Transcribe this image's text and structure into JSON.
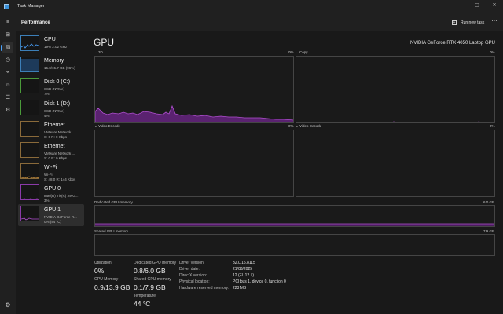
{
  "window": {
    "title": "Task Manager",
    "controls": {
      "minimize": "—",
      "maximize": "▢",
      "close": "✕"
    }
  },
  "header": {
    "page_title": "Performance",
    "run_new_task": "Run new task",
    "more": "⋯"
  },
  "rail_icons": [
    "hamburger-icon",
    "processes-icon",
    "performance-icon",
    "app-history-icon",
    "startup-apps-icon",
    "users-icon",
    "details-icon",
    "services-icon",
    "settings-icon"
  ],
  "sidebar": {
    "items": [
      {
        "name": "CPU",
        "sub1": "19%  2.02 GHz",
        "sub2": "",
        "sub3": ""
      },
      {
        "name": "Memory",
        "sub1": "15.0/15.7 GB (96%)",
        "sub2": "",
        "sub3": ""
      },
      {
        "name": "Disk 0 (C:)",
        "sub1": "SSD (NVMe)",
        "sub2": "7%",
        "sub3": ""
      },
      {
        "name": "Disk 1 (D:)",
        "sub1": "SSD (NVMe)",
        "sub2": "4%",
        "sub3": ""
      },
      {
        "name": "Ethernet",
        "sub1": "VMware Network ...",
        "sub2": "S: 0  R: 0 Kbps",
        "sub3": ""
      },
      {
        "name": "Ethernet",
        "sub1": "VMware Network ...",
        "sub2": "S: 0  R: 0 Kbps",
        "sub3": ""
      },
      {
        "name": "Wi-Fi",
        "sub1": "Wi-Fi",
        "sub2": "S: 48.0  R: 144 Kbps",
        "sub3": ""
      },
      {
        "name": "GPU 0",
        "sub1": "Intel(R) Iris(R) Xe G...",
        "sub2": "3%",
        "sub3": ""
      },
      {
        "name": "GPU 1",
        "sub1": "NVIDIA GeForce R...",
        "sub2": "0%  (44 °C)",
        "sub3": ""
      }
    ]
  },
  "main": {
    "heading": "GPU",
    "model": "NVIDIA GeForce RTX 4050 Laptop GPU",
    "graphs": {
      "g3d": {
        "label": "3D",
        "value": "0%"
      },
      "copy": {
        "label": "Copy",
        "value": "0%"
      },
      "encode": {
        "label": "Video Encode",
        "value": "0%"
      },
      "decode": {
        "label": "Video Decode",
        "value": "0%"
      },
      "dedicated": {
        "label": "Dedicated GPU memory",
        "max": "6.0 GB"
      },
      "shared": {
        "label": "Shared GPU memory",
        "max": "7.9 GB"
      }
    },
    "stats": {
      "utilization_label": "Utilization",
      "utilization": "0%",
      "dedicated_label": "Dedicated GPU memory",
      "dedicated": "0.8/6.0 GB",
      "gpu_memory_label": "GPU Memory",
      "gpu_memory": "0.9/13.9 GB",
      "shared_label": "Shared GPU memory",
      "shared": "0.1/7.9 GB",
      "temperature_label": "Temperature",
      "temperature": "44 °C"
    },
    "properties": [
      {
        "label": "Driver version:",
        "value": "32.0.15.8115"
      },
      {
        "label": "Driver date:",
        "value": "21/08/2025"
      },
      {
        "label": "DirectX version:",
        "value": "12 (FL 12.1)"
      },
      {
        "label": "Physical location:",
        "value": "PCI bus 1, device 0, function 0"
      },
      {
        "label": "Hardware reserved memory:",
        "value": "223 MB"
      }
    ]
  },
  "colors": {
    "accent": "#9b3fb8",
    "graph_fill": "#5a2270",
    "graph_line": "#b04fd0"
  }
}
